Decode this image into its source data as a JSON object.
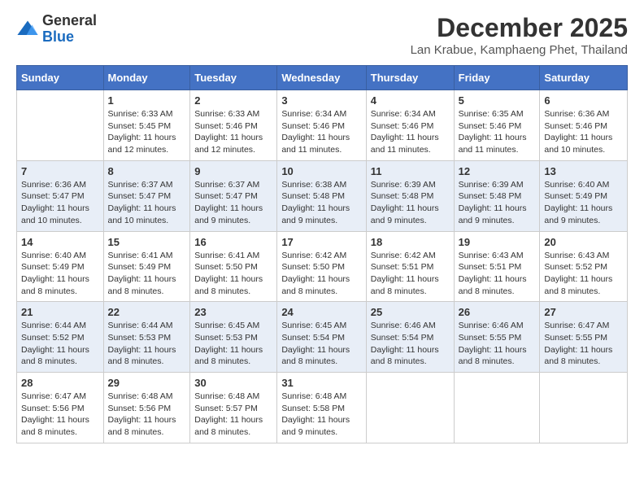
{
  "header": {
    "logo": {
      "general": "General",
      "blue": "Blue"
    },
    "title": "December 2025",
    "subtitle": "Lan Krabue, Kamphaeng Phet, Thailand"
  },
  "columns": [
    "Sunday",
    "Monday",
    "Tuesday",
    "Wednesday",
    "Thursday",
    "Friday",
    "Saturday"
  ],
  "weeks": [
    [
      {
        "num": "",
        "info": ""
      },
      {
        "num": "1",
        "info": "Sunrise: 6:33 AM\nSunset: 5:45 PM\nDaylight: 11 hours and 12 minutes."
      },
      {
        "num": "2",
        "info": "Sunrise: 6:33 AM\nSunset: 5:46 PM\nDaylight: 11 hours and 12 minutes."
      },
      {
        "num": "3",
        "info": "Sunrise: 6:34 AM\nSunset: 5:46 PM\nDaylight: 11 hours and 11 minutes."
      },
      {
        "num": "4",
        "info": "Sunrise: 6:34 AM\nSunset: 5:46 PM\nDaylight: 11 hours and 11 minutes."
      },
      {
        "num": "5",
        "info": "Sunrise: 6:35 AM\nSunset: 5:46 PM\nDaylight: 11 hours and 11 minutes."
      },
      {
        "num": "6",
        "info": "Sunrise: 6:36 AM\nSunset: 5:46 PM\nDaylight: 11 hours and 10 minutes."
      }
    ],
    [
      {
        "num": "7",
        "info": "Sunrise: 6:36 AM\nSunset: 5:47 PM\nDaylight: 11 hours and 10 minutes."
      },
      {
        "num": "8",
        "info": "Sunrise: 6:37 AM\nSunset: 5:47 PM\nDaylight: 11 hours and 10 minutes."
      },
      {
        "num": "9",
        "info": "Sunrise: 6:37 AM\nSunset: 5:47 PM\nDaylight: 11 hours and 9 minutes."
      },
      {
        "num": "10",
        "info": "Sunrise: 6:38 AM\nSunset: 5:48 PM\nDaylight: 11 hours and 9 minutes."
      },
      {
        "num": "11",
        "info": "Sunrise: 6:39 AM\nSunset: 5:48 PM\nDaylight: 11 hours and 9 minutes."
      },
      {
        "num": "12",
        "info": "Sunrise: 6:39 AM\nSunset: 5:48 PM\nDaylight: 11 hours and 9 minutes."
      },
      {
        "num": "13",
        "info": "Sunrise: 6:40 AM\nSunset: 5:49 PM\nDaylight: 11 hours and 9 minutes."
      }
    ],
    [
      {
        "num": "14",
        "info": "Sunrise: 6:40 AM\nSunset: 5:49 PM\nDaylight: 11 hours and 8 minutes."
      },
      {
        "num": "15",
        "info": "Sunrise: 6:41 AM\nSunset: 5:49 PM\nDaylight: 11 hours and 8 minutes."
      },
      {
        "num": "16",
        "info": "Sunrise: 6:41 AM\nSunset: 5:50 PM\nDaylight: 11 hours and 8 minutes."
      },
      {
        "num": "17",
        "info": "Sunrise: 6:42 AM\nSunset: 5:50 PM\nDaylight: 11 hours and 8 minutes."
      },
      {
        "num": "18",
        "info": "Sunrise: 6:42 AM\nSunset: 5:51 PM\nDaylight: 11 hours and 8 minutes."
      },
      {
        "num": "19",
        "info": "Sunrise: 6:43 AM\nSunset: 5:51 PM\nDaylight: 11 hours and 8 minutes."
      },
      {
        "num": "20",
        "info": "Sunrise: 6:43 AM\nSunset: 5:52 PM\nDaylight: 11 hours and 8 minutes."
      }
    ],
    [
      {
        "num": "21",
        "info": "Sunrise: 6:44 AM\nSunset: 5:52 PM\nDaylight: 11 hours and 8 minutes."
      },
      {
        "num": "22",
        "info": "Sunrise: 6:44 AM\nSunset: 5:53 PM\nDaylight: 11 hours and 8 minutes."
      },
      {
        "num": "23",
        "info": "Sunrise: 6:45 AM\nSunset: 5:53 PM\nDaylight: 11 hours and 8 minutes."
      },
      {
        "num": "24",
        "info": "Sunrise: 6:45 AM\nSunset: 5:54 PM\nDaylight: 11 hours and 8 minutes."
      },
      {
        "num": "25",
        "info": "Sunrise: 6:46 AM\nSunset: 5:54 PM\nDaylight: 11 hours and 8 minutes."
      },
      {
        "num": "26",
        "info": "Sunrise: 6:46 AM\nSunset: 5:55 PM\nDaylight: 11 hours and 8 minutes."
      },
      {
        "num": "27",
        "info": "Sunrise: 6:47 AM\nSunset: 5:55 PM\nDaylight: 11 hours and 8 minutes."
      }
    ],
    [
      {
        "num": "28",
        "info": "Sunrise: 6:47 AM\nSunset: 5:56 PM\nDaylight: 11 hours and 8 minutes."
      },
      {
        "num": "29",
        "info": "Sunrise: 6:48 AM\nSunset: 5:56 PM\nDaylight: 11 hours and 8 minutes."
      },
      {
        "num": "30",
        "info": "Sunrise: 6:48 AM\nSunset: 5:57 PM\nDaylight: 11 hours and 8 minutes."
      },
      {
        "num": "31",
        "info": "Sunrise: 6:48 AM\nSunset: 5:58 PM\nDaylight: 11 hours and 9 minutes."
      },
      {
        "num": "",
        "info": ""
      },
      {
        "num": "",
        "info": ""
      },
      {
        "num": "",
        "info": ""
      }
    ]
  ]
}
